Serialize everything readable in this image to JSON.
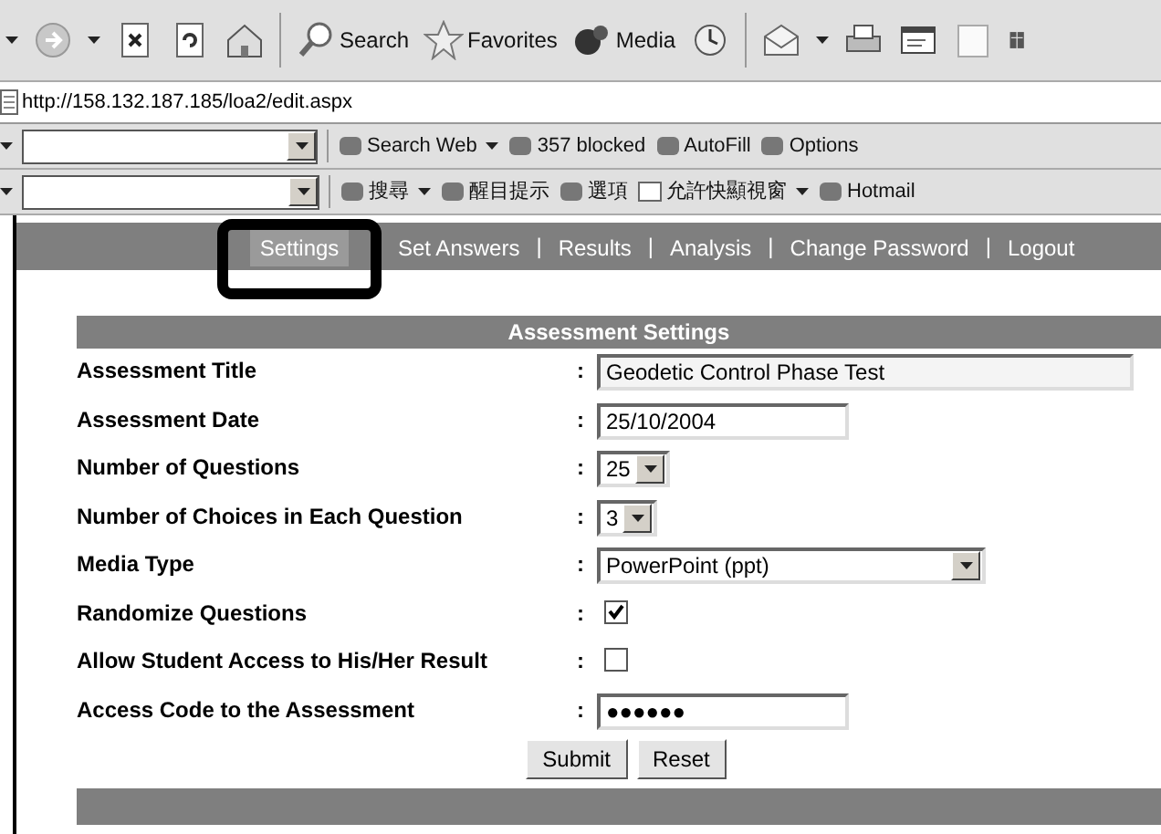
{
  "toolbar": {
    "forward": {
      "disabled": true
    },
    "buttons": [
      "Search",
      "Favorites",
      "Media"
    ]
  },
  "address": {
    "url": "http://158.132.187.185/loa2/edit.aspx"
  },
  "search_bar_1": {
    "items": [
      "Search Web",
      "357 blocked",
      "AutoFill",
      "Options"
    ]
  },
  "search_bar_2": {
    "items": [
      "搜尋",
      "醒目提示",
      "選項",
      "允許快顯視窗",
      "Hotmail"
    ]
  },
  "nav": {
    "items": [
      {
        "kind": "link",
        "label": "Settings",
        "selected": true,
        "circled": true
      },
      {
        "kind": "link",
        "label": "Set Answers",
        "selected": false,
        "circled": false
      },
      {
        "kind": "separator",
        "label": "|"
      },
      {
        "kind": "link",
        "label": "Results",
        "selected": false,
        "circled": false
      },
      {
        "kind": "separator",
        "label": "|"
      },
      {
        "kind": "link",
        "label": "Analysis",
        "selected": false,
        "circled": false
      },
      {
        "kind": "separator",
        "label": "|"
      },
      {
        "kind": "link",
        "label": "Change Password",
        "selected": false,
        "circled": false
      },
      {
        "kind": "separator",
        "label": "|"
      },
      {
        "kind": "link",
        "label": "Logout",
        "selected": false,
        "circled": false
      }
    ]
  },
  "form": {
    "title": "Assessment Settings",
    "separator": ":",
    "fields": [
      {
        "kind": "text",
        "label": "Assessment Title",
        "value": "Geodetic Control Phase Test"
      },
      {
        "kind": "text",
        "label": "Assessment Date",
        "value": "25/10/2004"
      },
      {
        "kind": "select",
        "label": "Number of Questions",
        "value": "25"
      },
      {
        "kind": "select",
        "label": "Number of Choices in Each Question",
        "value": "3"
      },
      {
        "kind": "select",
        "label": "Media Type",
        "value": "PowerPoint (ppt)"
      },
      {
        "kind": "checkbox",
        "label": "Randomize Questions",
        "checked": true
      },
      {
        "kind": "checkbox",
        "label": "Allow Student Access to His/Her Result",
        "checked": false
      },
      {
        "kind": "password",
        "label": "Access Code to the Assessment",
        "value": "●●●●●●"
      }
    ],
    "buttons": [
      "Submit",
      "Reset"
    ]
  }
}
